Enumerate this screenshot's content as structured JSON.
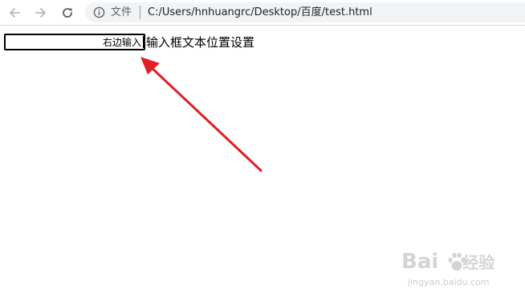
{
  "browser": {
    "security_label": "文件",
    "url": "C:/Users/hnhuangrc/Desktop/百度/test.html"
  },
  "page": {
    "input_value": "右边输入",
    "label": "输入框文本位置设置"
  },
  "annotation": {
    "arrow_color": "#e02025"
  },
  "watermark": {
    "logo_text_left": "Bai",
    "logo_text_right": "经验",
    "site": "jingyan.baidu.com"
  },
  "icons": [
    "back-arrow-icon",
    "forward-arrow-icon",
    "reload-icon",
    "info-icon",
    "paw-icon"
  ]
}
